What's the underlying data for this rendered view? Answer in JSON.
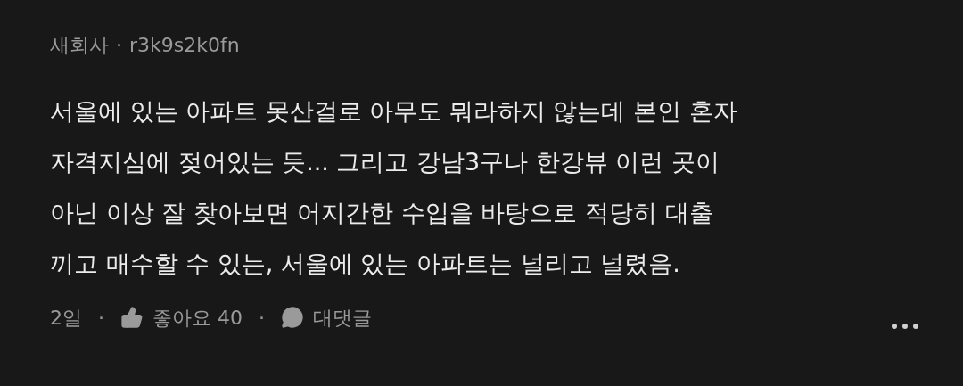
{
  "comment": {
    "author": "새회사",
    "separator": "·",
    "user_id": "r3k9s2k0fn",
    "body": "서울에 있는 아파트 못산걸로 아무도 뭐라하지 않는데 본인 혼자\n자격지심에 젖어있는 듯... 그리고 강남3구나 한강뷰 이런 곳이\n아닌 이상 잘 찾아보면 어지간한 수입을 바탕으로 적당히 대출\n끼고 매수할 수 있는, 서울에 있는 아파트는 널리고 널렸음.",
    "time": "2일",
    "dot_1": "·",
    "like_label": "좋아요 40",
    "dot_2": "·",
    "reply_label": "대댓글"
  }
}
